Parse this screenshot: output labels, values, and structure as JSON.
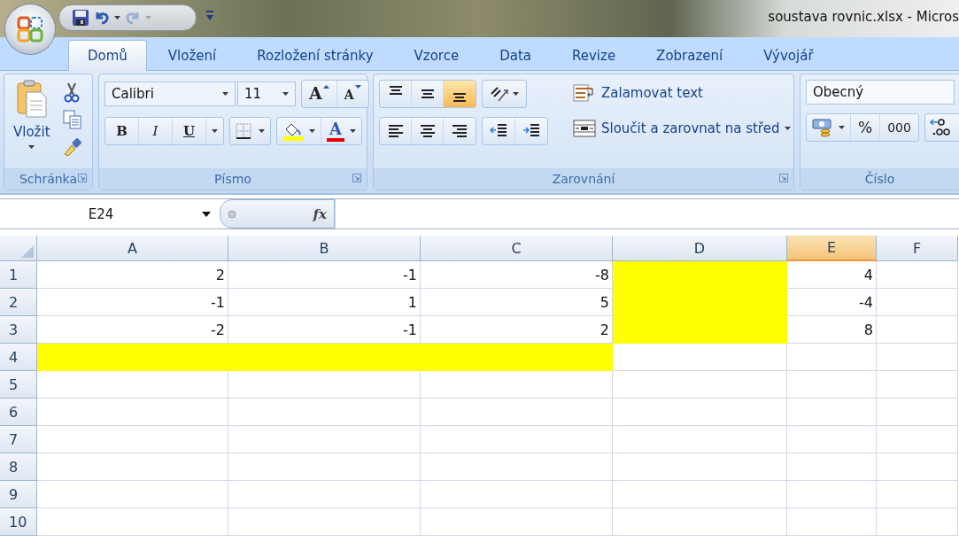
{
  "window": {
    "title": "soustava rovnic.xlsx - Micros"
  },
  "quick_access": {
    "redo_disabled": true
  },
  "tabs": [
    {
      "label": "Domů",
      "selected": true
    },
    {
      "label": "Vložení",
      "selected": false
    },
    {
      "label": "Rozložení stránky",
      "selected": false
    },
    {
      "label": "Vzorce",
      "selected": false
    },
    {
      "label": "Data",
      "selected": false
    },
    {
      "label": "Revize",
      "selected": false
    },
    {
      "label": "Zobrazení",
      "selected": false
    },
    {
      "label": "Vývojář",
      "selected": false
    }
  ],
  "ribbon": {
    "clipboard": {
      "title": "Schránka",
      "paste_label": "Vložit"
    },
    "font": {
      "title": "Písmo",
      "font_name": "Calibri",
      "font_size": "11",
      "grow": "A",
      "shrink": "A",
      "styles": [
        "B",
        "I",
        "U"
      ],
      "font_color": "A"
    },
    "alignment": {
      "title": "Zarovnání",
      "vertical": [
        {
          "selected": false
        },
        {
          "selected": false
        },
        {
          "selected": true
        }
      ],
      "wrap_label": "Zalamovat text",
      "merge_label": "Sloučit a zarovnat na střed"
    },
    "number": {
      "title": "Číslo",
      "format": "Obecný",
      "percent": "%",
      "thousands": "000"
    }
  },
  "formula_bar": {
    "name_box": "E24",
    "fx": "fx"
  },
  "sheet": {
    "columns": [
      {
        "label": "A",
        "selected": false
      },
      {
        "label": "B",
        "selected": false
      },
      {
        "label": "C",
        "selected": false
      },
      {
        "label": "D",
        "selected": false
      },
      {
        "label": "E",
        "selected": true
      },
      {
        "label": "F",
        "selected": false
      }
    ],
    "rows": [
      {
        "label": "1",
        "cells": [
          {
            "value": "2",
            "highlighted": false
          },
          {
            "value": "-1",
            "highlighted": false
          },
          {
            "value": "-8",
            "highlighted": false
          },
          {
            "highlighted": true
          },
          {
            "value": "4",
            "highlighted": false
          },
          {
            "highlighted": false
          }
        ]
      },
      {
        "label": "2",
        "cells": [
          {
            "value": "-1",
            "highlighted": false
          },
          {
            "value": "1",
            "highlighted": false
          },
          {
            "value": "5",
            "highlighted": false
          },
          {
            "highlighted": true
          },
          {
            "value": "-4",
            "highlighted": false
          },
          {
            "highlighted": false
          }
        ]
      },
      {
        "label": "3",
        "cells": [
          {
            "value": "-2",
            "highlighted": false
          },
          {
            "value": "-1",
            "highlighted": false
          },
          {
            "value": "2",
            "highlighted": false
          },
          {
            "highlighted": true
          },
          {
            "value": "8",
            "highlighted": false
          },
          {
            "highlighted": false
          }
        ]
      },
      {
        "label": "4",
        "cells": [
          {
            "highlighted": true
          },
          {
            "highlighted": true
          },
          {
            "highlighted": true
          },
          {
            "highlighted": false
          },
          {
            "highlighted": false
          },
          {
            "highlighted": false
          }
        ]
      },
      {
        "label": "5",
        "cells": []
      },
      {
        "label": "6",
        "cells": []
      },
      {
        "label": "7",
        "cells": []
      },
      {
        "label": "8",
        "cells": []
      },
      {
        "label": "9",
        "cells": []
      },
      {
        "label": "10",
        "cells": []
      }
    ]
  }
}
